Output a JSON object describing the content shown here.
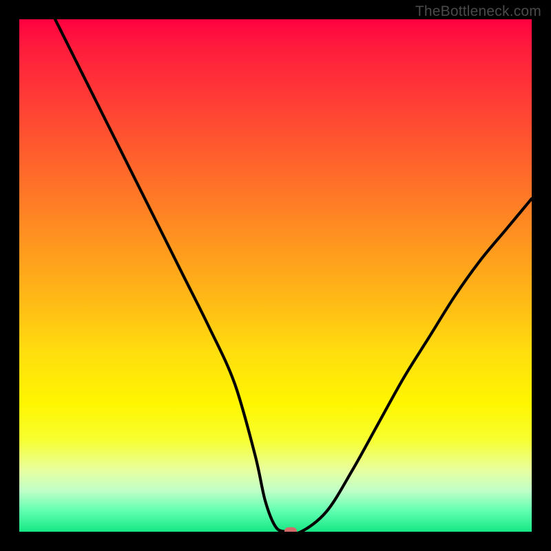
{
  "watermark": "TheBottleneck.com",
  "colors": {
    "frame": "#000000",
    "gradient_top": "#ff0040",
    "gradient_bottom": "#16e784",
    "curve": "#000000",
    "marker": "#d46a6a"
  },
  "chart_data": {
    "type": "line",
    "title": "",
    "xlabel": "",
    "ylabel": "",
    "xlim": [
      0,
      100
    ],
    "ylim": [
      0,
      100
    ],
    "legend": false,
    "grid": false,
    "series": [
      {
        "name": "bottleneck-curve",
        "x": [
          7,
          12,
          17,
          22,
          27,
          32,
          37,
          42,
          46,
          48,
          50,
          52,
          55,
          60,
          65,
          70,
          75,
          80,
          85,
          90,
          95,
          100
        ],
        "y": [
          100,
          90,
          80,
          70,
          60,
          50,
          40,
          29,
          15,
          6,
          1,
          0,
          0,
          4,
          12,
          21,
          30,
          38,
          46,
          53,
          59,
          65
        ]
      }
    ],
    "marker": {
      "x": 53,
      "y": 0
    }
  }
}
